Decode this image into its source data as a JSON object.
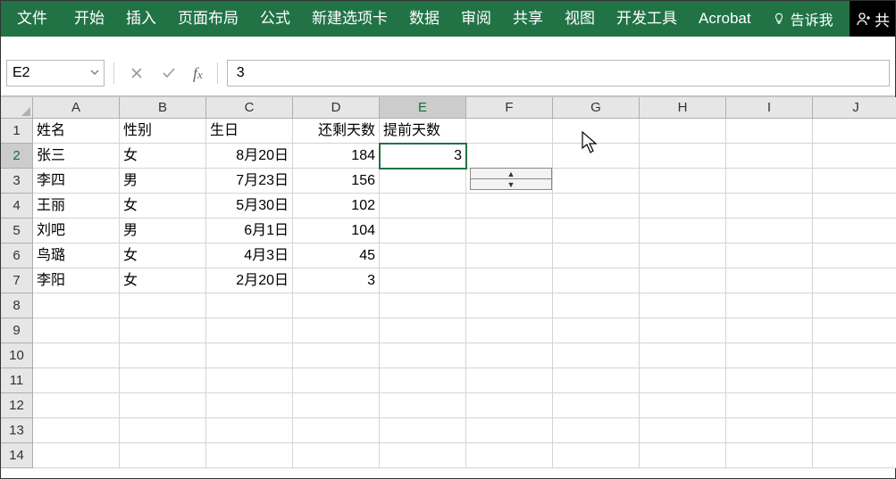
{
  "ribbon": {
    "file": "文件",
    "tabs": [
      "开始",
      "插入",
      "页面布局",
      "公式",
      "新建选项卡",
      "数据",
      "审阅",
      "共享",
      "视图",
      "开发工具",
      "Acrobat"
    ],
    "tell_me": "告诉我",
    "share_right": "共"
  },
  "formula": {
    "name_box": "E2",
    "formula_value": "3"
  },
  "columns": [
    "A",
    "B",
    "C",
    "D",
    "E",
    "F",
    "G",
    "H",
    "I",
    "J"
  ],
  "row_numbers": [
    "1",
    "2",
    "3",
    "4",
    "5",
    "6",
    "7",
    "8",
    "9",
    "10",
    "11",
    "12",
    "13",
    "14"
  ],
  "headers": [
    "姓名",
    "性别",
    "生日",
    "还剩天数",
    "提前天数"
  ],
  "rows": [
    {
      "a": "张三",
      "b": "女",
      "c": "8月20日",
      "d": "184",
      "e": "3"
    },
    {
      "a": "李四",
      "b": "男",
      "c": "7月23日",
      "d": "156",
      "e": ""
    },
    {
      "a": "王丽",
      "b": "女",
      "c": "5月30日",
      "d": "102",
      "e": ""
    },
    {
      "a": "刘吧",
      "b": "男",
      "c": "6月1日",
      "d": "104",
      "e": ""
    },
    {
      "a": "鸟璐",
      "b": "女",
      "c": "4月3日",
      "d": "45",
      "e": ""
    },
    {
      "a": "李阳",
      "b": "女",
      "c": "2月20日",
      "d": "3",
      "e": ""
    }
  ],
  "chart_data": {
    "type": "table",
    "columns": [
      "姓名",
      "性别",
      "生日",
      "还剩天数",
      "提前天数"
    ],
    "data": [
      [
        "张三",
        "女",
        "8月20日",
        184,
        3
      ],
      [
        "李四",
        "男",
        "7月23日",
        156,
        null
      ],
      [
        "王丽",
        "女",
        "5月30日",
        102,
        null
      ],
      [
        "刘吧",
        "男",
        "6月1日",
        104,
        null
      ],
      [
        "鸟璐",
        "女",
        "4月3日",
        45,
        null
      ],
      [
        "李阳",
        "女",
        "2月20日",
        3,
        null
      ]
    ]
  }
}
